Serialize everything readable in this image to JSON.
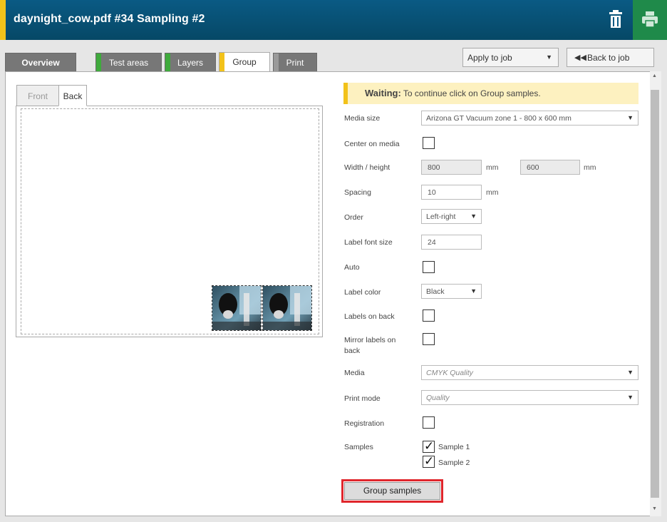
{
  "title": "daynight_cow.pdf #34 Sampling #2",
  "colors": {
    "title_bg": "#064866",
    "accent": "#f2c21a",
    "green": "#1f8a4a",
    "alert": "#e0262c"
  },
  "tabs": [
    {
      "label": "Overview"
    },
    {
      "label": "Test areas"
    },
    {
      "label": "Layers"
    },
    {
      "label": "Group"
    },
    {
      "label": "Print"
    }
  ],
  "apply_select": {
    "value": "Apply to job"
  },
  "back_button": {
    "label": "Back to job"
  },
  "preview": {
    "tabs": [
      "Front",
      "Back"
    ]
  },
  "status": {
    "prefix": "Waiting:",
    "message": "To continue click on Group samples."
  },
  "form": {
    "media_size": {
      "label": "Media size",
      "value": "Arizona GT Vacuum zone 1 - 800 x 600 mm"
    },
    "center_on_media": {
      "label": "Center on media",
      "checked": false
    },
    "width_height": {
      "label": "Width / height",
      "width": "800",
      "height": "600",
      "unit": "mm"
    },
    "spacing": {
      "label": "Spacing",
      "value": "10",
      "unit": "mm"
    },
    "order": {
      "label": "Order",
      "value": "Left-right"
    },
    "label_font_size": {
      "label": "Label font size",
      "value": "24"
    },
    "auto": {
      "label": "Auto",
      "checked": false
    },
    "label_color": {
      "label": "Label color",
      "value": "Black"
    },
    "labels_on_back": {
      "label": "Labels on back",
      "checked": false
    },
    "mirror_labels": {
      "label_line1": "Mirror labels on",
      "label_line2": "back",
      "checked": false
    },
    "media": {
      "label": "Media",
      "value": "CMYK Quality"
    },
    "print_mode": {
      "label": "Print mode",
      "value": "Quality"
    },
    "registration": {
      "label": "Registration",
      "checked": false
    },
    "samples": {
      "label": "Samples",
      "items": [
        {
          "name": "Sample 1",
          "checked": true
        },
        {
          "name": "Sample 2",
          "checked": true
        }
      ]
    }
  },
  "group_button": {
    "label": "Group samples"
  }
}
